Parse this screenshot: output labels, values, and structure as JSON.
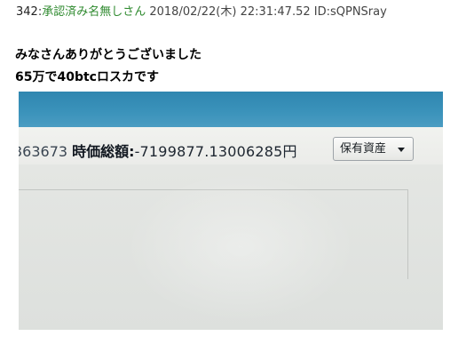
{
  "post": {
    "number": "342",
    "separator": ":",
    "name": "承認済み名無しさん",
    "meta": " 2018/02/22(木) 22:31:47.52 ID:sQPNSray",
    "lines": [
      "みなさんありがとうございました",
      "65万で40btcロスカです"
    ]
  },
  "screen": {
    "value_id_fragment": "363673",
    "total_label": "時価総額:",
    "total_value": "-7199877.13006285円",
    "asset_button_label": "保有資産",
    "asset_button_icon": "caret-down-icon"
  },
  "colors": {
    "poster_name": "#2f8a2f",
    "screen_header": "#3a92ba"
  }
}
